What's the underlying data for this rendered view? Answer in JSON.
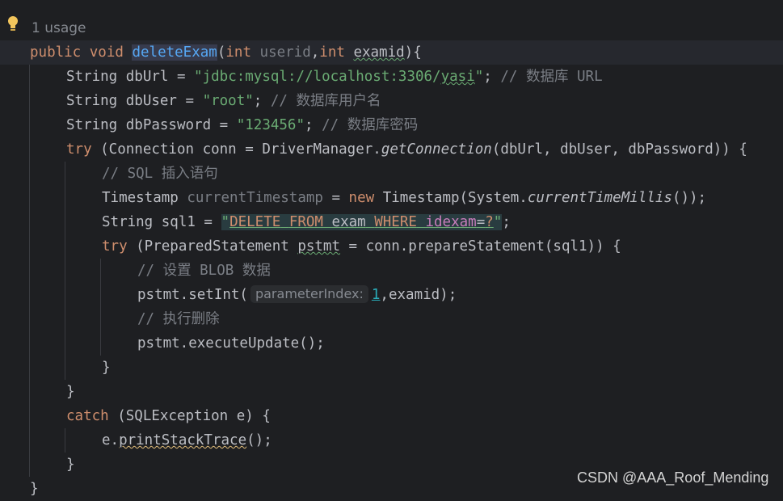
{
  "gutter": {
    "usage_label": "1 usage"
  },
  "code": {
    "l1": {
      "kw1": "public",
      "kw2": "void",
      "method": "deleteExam",
      "paren": "(",
      "type1": "int",
      "param1": "userid",
      "comma": ",",
      "type2": "int",
      "param2": "examid",
      "end": "){"
    },
    "l2": {
      "decl": "String dbUrl = ",
      "value": "\"jdbc:mysql://localhost:3306/",
      "value_tail": "yasi",
      "value_end": "\"",
      "semi": ";",
      "comment": " // 数据库 URL"
    },
    "l3": {
      "decl": "String dbUser = ",
      "value": "\"root\"",
      "semi": ";",
      "comment": " // 数据库用户名"
    },
    "l4": {
      "decl": "String dbPassword = ",
      "value": "\"123456\"",
      "semi": ";",
      "comment": " // 数据库密码"
    },
    "l5": {
      "kw": "try",
      "pre": " (Connection conn = DriverManager.",
      "call": "getConnection",
      "post": "(dbUrl, dbUser, dbPassword)) {"
    },
    "l6": {
      "comment": "// SQL 插入语句"
    },
    "l7": {
      "type": "Timestamp ",
      "var": "currentTimestamp",
      "eq": " = ",
      "kw": "new",
      "pre": " Timestamp(System.",
      "call": "currentTimeMillis",
      "post": "());"
    },
    "l8": {
      "decl": "String sql1 = ",
      "q1": "\"",
      "s_delete": "DELETE",
      "s_sp1": " ",
      "s_from": "FROM",
      "s_sp2": " ",
      "s_exam": "exam",
      "s_sp3": " ",
      "s_where": "WHERE",
      "s_sp4": " ",
      "s_col": "idexam",
      "s_eq": "=",
      "s_ph": "?",
      "q2": "\"",
      "semi": ";"
    },
    "l9": {
      "kw": "try",
      "pre": " (PreparedStatement ",
      "var": "pstmt",
      "post": " = conn.prepareStatement(sql1)) {"
    },
    "l10": {
      "comment": "// 设置 BLOB 数据"
    },
    "l11": {
      "pre": "pstmt.setInt(",
      "hint": "parameterIndex:",
      "num": "1",
      "post": ",examid);"
    },
    "l12": {
      "comment": "// 执行删除"
    },
    "l13": {
      "text": "pstmt.executeUpdate();"
    },
    "l14": {
      "text": "}"
    },
    "l15": {
      "text": "}"
    },
    "l16": {
      "kw": "catch",
      "post": " (SQLException e) {"
    },
    "l17": {
      "pre": "e.",
      "call": "printStackTrace",
      "post": "();"
    },
    "l18": {
      "text": "}"
    },
    "l19": {
      "text": "}"
    }
  },
  "watermark": {
    "text": "CSDN @AAA_Roof_Mending"
  },
  "colors": {
    "background": "#1e1f22",
    "keyword": "#cf8e6d",
    "method": "#56a8f5",
    "string": "#6aab73",
    "comment": "#7a7e85",
    "number": "#2aacb8"
  }
}
